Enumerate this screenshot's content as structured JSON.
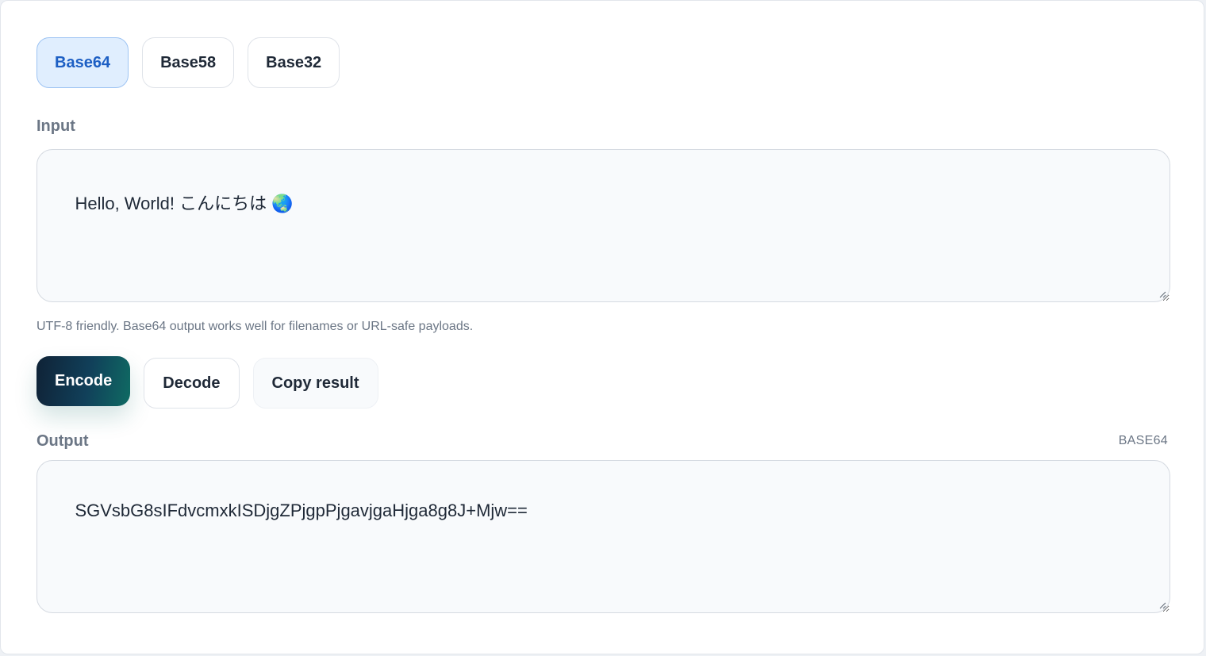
{
  "tabs": [
    {
      "label": "Base64",
      "active": true
    },
    {
      "label": "Base58",
      "active": false
    },
    {
      "label": "Base32",
      "active": false
    }
  ],
  "input": {
    "label": "Input",
    "value": "Hello, World! こんにちは 🌏",
    "hint": "UTF-8 friendly. Base64 output works well for filenames or URL-safe payloads."
  },
  "actions": {
    "encode_label": "Encode",
    "decode_label": "Decode",
    "copy_label": "Copy result"
  },
  "output": {
    "label": "Output",
    "format": "BASE64",
    "value": "SGVsbG8sIFdvcmxkISDjgZPjgpPjgavjgaHjga8g8J+Mjw=="
  },
  "colors": {
    "active_tab_bg": "#e0eefe",
    "active_tab_text": "#1d5fc4",
    "primary_gradient_start": "#0f2236",
    "primary_gradient_end": "#0f6b63",
    "muted_text": "#6b7685"
  },
  "icons": {
    "resize": "resize-grip-icon"
  }
}
